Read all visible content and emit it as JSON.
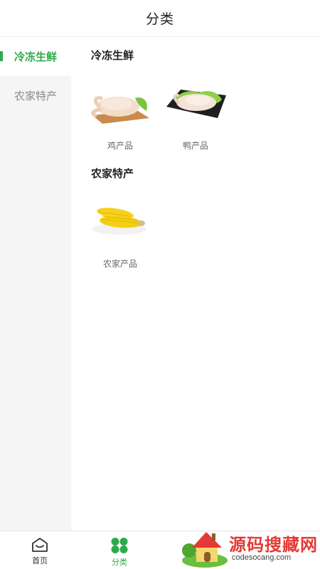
{
  "header": {
    "title": "分类"
  },
  "sidebar": {
    "items": [
      {
        "label": "冷冻生鲜",
        "active": true
      },
      {
        "label": "农家特产",
        "active": false
      }
    ]
  },
  "sections": [
    {
      "title": "冷冻生鲜",
      "products": [
        {
          "name": "鸡产品",
          "icon": "chicken-icon"
        },
        {
          "name": "鸭产品",
          "icon": "duck-icon"
        }
      ]
    },
    {
      "title": "农家特产",
      "products": [
        {
          "name": "农家产品",
          "icon": "corn-icon"
        }
      ]
    }
  ],
  "tabbar": {
    "tabs": [
      {
        "label": "首页",
        "icon": "home-icon",
        "active": false
      },
      {
        "label": "分类",
        "icon": "category-icon",
        "active": true
      }
    ]
  },
  "watermark": {
    "title": "源码搜藏网",
    "url": "codesocang.com"
  },
  "colors": {
    "accent": "#2eaa4a",
    "sidebar_bg": "#f5f5f5",
    "watermark_red": "#e53935"
  }
}
